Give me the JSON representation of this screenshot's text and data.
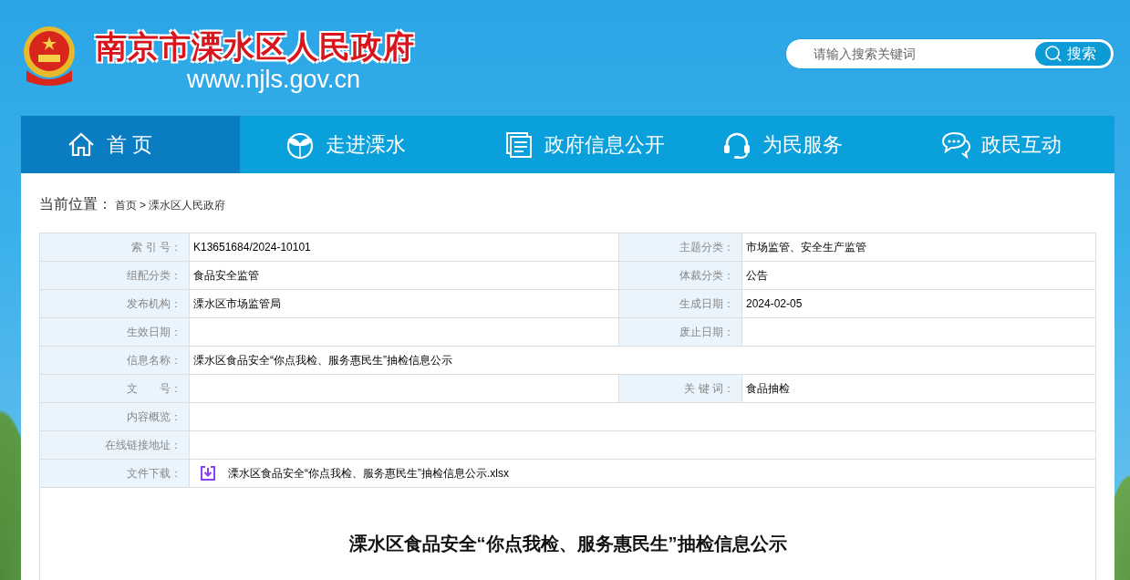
{
  "header": {
    "site_title": "南京市溧水区人民政府",
    "site_url": "www.njls.gov.cn",
    "search": {
      "placeholder": "请输入搜索关键词",
      "button": "搜索"
    }
  },
  "nav": [
    {
      "label": "首 页",
      "selected": true
    },
    {
      "label": "走进溧水",
      "selected": false
    },
    {
      "label": "政府信息公开",
      "selected": false
    },
    {
      "label": "为民服务",
      "selected": false
    },
    {
      "label": "政民互动",
      "selected": false
    }
  ],
  "breadcrumb": {
    "label": "当前位置：",
    "items": [
      "首页",
      "溧水区人民政府"
    ],
    "separator": ">"
  },
  "info_rows": [
    {
      "kind": "pair",
      "fields": [
        {
          "label": "索 引 号：",
          "value": "K13651684/2024-10101"
        },
        {
          "label": "主题分类：",
          "value": "市场监管、安全生产监管"
        }
      ]
    },
    {
      "kind": "pair",
      "fields": [
        {
          "label": "组配分类：",
          "value": "食品安全监管"
        },
        {
          "label": "体裁分类：",
          "value": "公告"
        }
      ]
    },
    {
      "kind": "pair",
      "fields": [
        {
          "label": "发布机构：",
          "value": "溧水区市场监管局"
        },
        {
          "label": "生成日期：",
          "value": "2024-02-05"
        }
      ]
    },
    {
      "kind": "pair",
      "fields": [
        {
          "label": "生效日期："
        },
        {
          "label": "废止日期："
        }
      ]
    },
    {
      "kind": "full",
      "fields": [
        {
          "label": "信息名称：",
          "value": "溧水区食品安全“你点我检、服务惠民生”抽检信息公示"
        }
      ]
    },
    {
      "kind": "pair",
      "fields": [
        {
          "label": "文　　号："
        },
        {
          "label": "关 键 词：",
          "value": "食品抽检"
        }
      ]
    },
    {
      "kind": "full",
      "fields": [
        {
          "label": "内容概览："
        }
      ]
    },
    {
      "kind": "full",
      "fields": [
        {
          "label": "在线链接地址："
        }
      ]
    },
    {
      "kind": "file",
      "fields": [
        {
          "label": "文件下载：",
          "value": "溧水区食品安全“你点我检、服务惠民生”抽检信息公示.xlsx"
        }
      ]
    }
  ],
  "article": {
    "title": "溧水区食品安全“你点我检、服务惠民生”抽检信息公示"
  }
}
